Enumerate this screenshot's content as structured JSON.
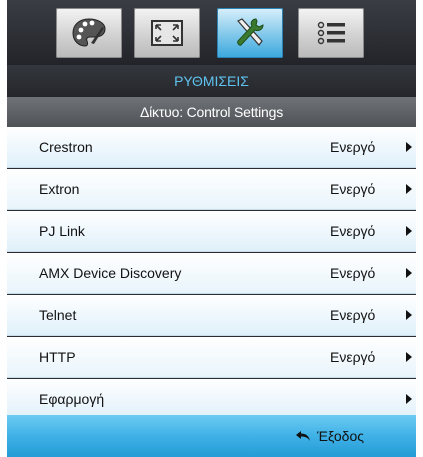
{
  "tabs": [
    {
      "name": "palette-icon",
      "active": false
    },
    {
      "name": "screen-icon",
      "active": false
    },
    {
      "name": "tools-icon",
      "active": true
    },
    {
      "name": "options-list-icon",
      "active": false
    }
  ],
  "header": {
    "title": "ΡΥΘΜΙΣΕΙΣ",
    "subtitle": "Δίκτυο: Control Settings"
  },
  "menu": {
    "items": [
      {
        "label": "Crestron",
        "value": "Ενεργό"
      },
      {
        "label": "Extron",
        "value": "Ενεργό"
      },
      {
        "label": "PJ Link",
        "value": "Ενεργό"
      },
      {
        "label": "AMX Device Discovery",
        "value": "Ενεργό"
      },
      {
        "label": "Telnet",
        "value": "Ενεργό"
      },
      {
        "label": "HTTP",
        "value": "Ενεργό"
      },
      {
        "label": "Εφαρμογή",
        "value": ""
      }
    ]
  },
  "footer": {
    "exit_label": "Έξοδος"
  },
  "colors": {
    "accent": "#3fb1e6",
    "title_text": "#5fc3f0",
    "panel_dark": "#2a2d33"
  }
}
